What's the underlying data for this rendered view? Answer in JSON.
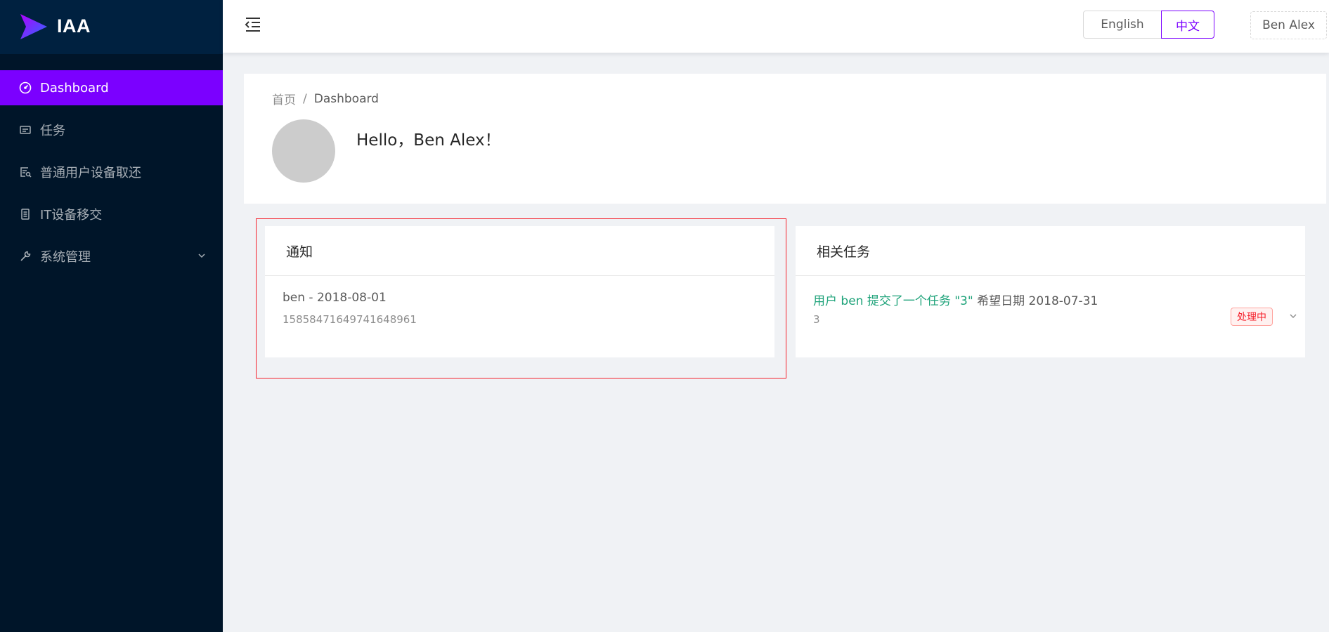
{
  "app": {
    "logo_text": "IAA"
  },
  "sidebar": {
    "items": [
      {
        "label": "Dashboard",
        "icon": "dashboard-icon",
        "active": true
      },
      {
        "label": "任务",
        "icon": "task-icon"
      },
      {
        "label": "普通用户设备取还",
        "icon": "device-request-icon"
      },
      {
        "label": "IT设备移交",
        "icon": "handover-icon"
      },
      {
        "label": "系统管理",
        "icon": "tool-icon",
        "has_submenu": true
      }
    ]
  },
  "header": {
    "lang": {
      "english": "English",
      "chinese": "中文",
      "active": "中文"
    },
    "user_name": "Ben Alex"
  },
  "page_header": {
    "breadcrumb": {
      "home": "首页",
      "separator": "/",
      "current": "Dashboard"
    },
    "greeting": "Hello，Ben Alex！"
  },
  "notice_card": {
    "title": "通知",
    "items": [
      {
        "title": "ben - 2018-08-01",
        "description": "15858471649741648961"
      }
    ]
  },
  "task_card": {
    "title": "相关任务",
    "items": [
      {
        "link_text": "用户 ben 提交了一个任务 \"3\"",
        "suffix": "希望日期 2018-07-31",
        "description": "3",
        "status": "处理中"
      }
    ]
  },
  "colors": {
    "sidebar_bg": "#001529",
    "logo_bg": "#002140",
    "accent": "#7b00ff",
    "link_green": "#1fa37a",
    "status_red": "#f5222d"
  }
}
